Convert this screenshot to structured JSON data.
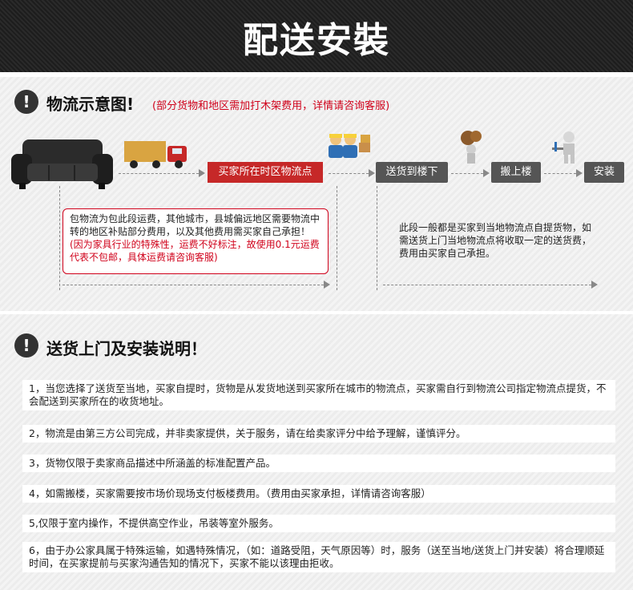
{
  "banner": {
    "title": "配送安裝"
  },
  "logistics": {
    "title": "物流示意图!",
    "note": "(部分货物和地区需加打木架费用，详情请咨询客服)",
    "steps": [
      "买家所在时区物流点",
      "送货到楼下",
      "搬上楼",
      "安装"
    ],
    "box_text_plain": "包物流为包此段运费，其他城市，县城偏远地区需要物流中转的地区补贴部分费用，以及其他费用需买家自己承担！",
    "box_text_red": "(因为家具行业的特殊性，运费不好标注，故使用0.1元运费代表不包邮，具体运费请咨询客服)",
    "right_text": "此段一般都是买家到当地物流点自提货物，如需送货上门当地物流点将收取一定的送货费，费用由买家自己承担。"
  },
  "delivery": {
    "title": "送货上门及安装说明！",
    "items": [
      "1，当您选择了送货至当地，买家自提时，货物是从发货地送到买家所在城市的物流点，买家需自行到物流公司指定物流点提货，不会配送到买家所在的收货地址。",
      "2，物流是由第三方公司完成，并非卖家提供，关于服务，请在给卖家评分中给予理解，谨慎评分。",
      "3，货物仅限于卖家商品描述中所涵盖的标准配置产品。",
      "4，如需搬楼，买家需要按市场价现场支付板楼费用。（费用由买家承担，详情请咨询客服）",
      "5,仅限于室内操作，不提供高空作业，吊装等室外服务。",
      "6，由于办公家具属于特殊运输，如遇特殊情况，（如：道路受阻，天气原因等）时，服务（送至当地/送货上门并安装）将合理顺延时间，在买家提前与买家沟通告知的情况下，买家不能以该理由拒收。"
    ]
  },
  "colors": {
    "accent_red": "#c62828",
    "dark": "#222222",
    "step_gray": "#555555"
  }
}
